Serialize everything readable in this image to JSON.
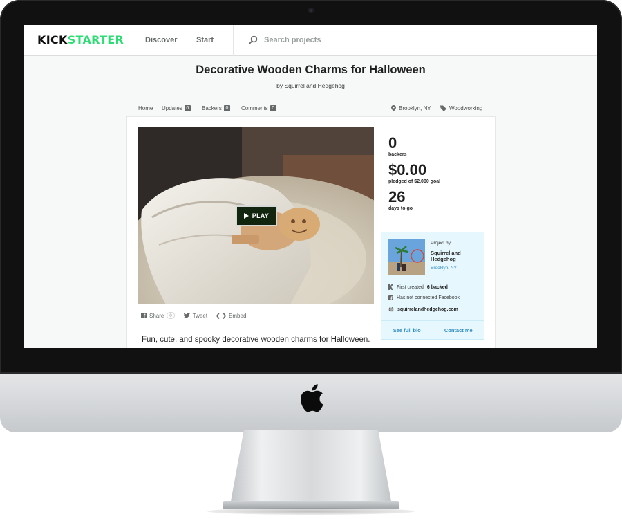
{
  "nav": {
    "logo_part1": "KICK",
    "logo_part2": "STARTER",
    "discover": "Discover",
    "start": "Start",
    "search_placeholder": "Search projects"
  },
  "project": {
    "title": "Decorative Wooden Charms for Halloween",
    "by_prefix": "by",
    "creator": "Squirrel and Hedgehog",
    "blurb": "Fun, cute, and spooky decorative wooden charms for Halloween."
  },
  "subnav": {
    "home": "Home",
    "updates": "Updates",
    "updates_count": "0",
    "backers": "Backers",
    "backers_count": "0",
    "comments": "Comments",
    "comments_count": "0",
    "location": "Brooklyn, NY",
    "category": "Woodworking"
  },
  "video": {
    "play_label": "PLAY"
  },
  "share": {
    "share_label": "Share",
    "share_count": "0",
    "tweet_label": "Tweet",
    "embed_label": "Embed"
  },
  "stats": {
    "backers_value": "0",
    "backers_label": "backers",
    "pledged_value": "$0.00",
    "pledged_label": "pledged of $2,000 goal",
    "days_value": "26",
    "days_label": "days to go"
  },
  "creator_box": {
    "project_by": "Project by",
    "name": "Squirrel and Hedgehog",
    "location": "Brooklyn, NY",
    "first_created": "First created",
    "backed": "6 backed",
    "facebook": "Has not connected Facebook",
    "website": "squirrelandhedgehog.com",
    "see_bio": "See full bio",
    "contact": "Contact me"
  },
  "colors": {
    "brand_green": "#2bde73",
    "link_blue": "#2e8cc4",
    "creator_bg": "#e6f7fd"
  }
}
